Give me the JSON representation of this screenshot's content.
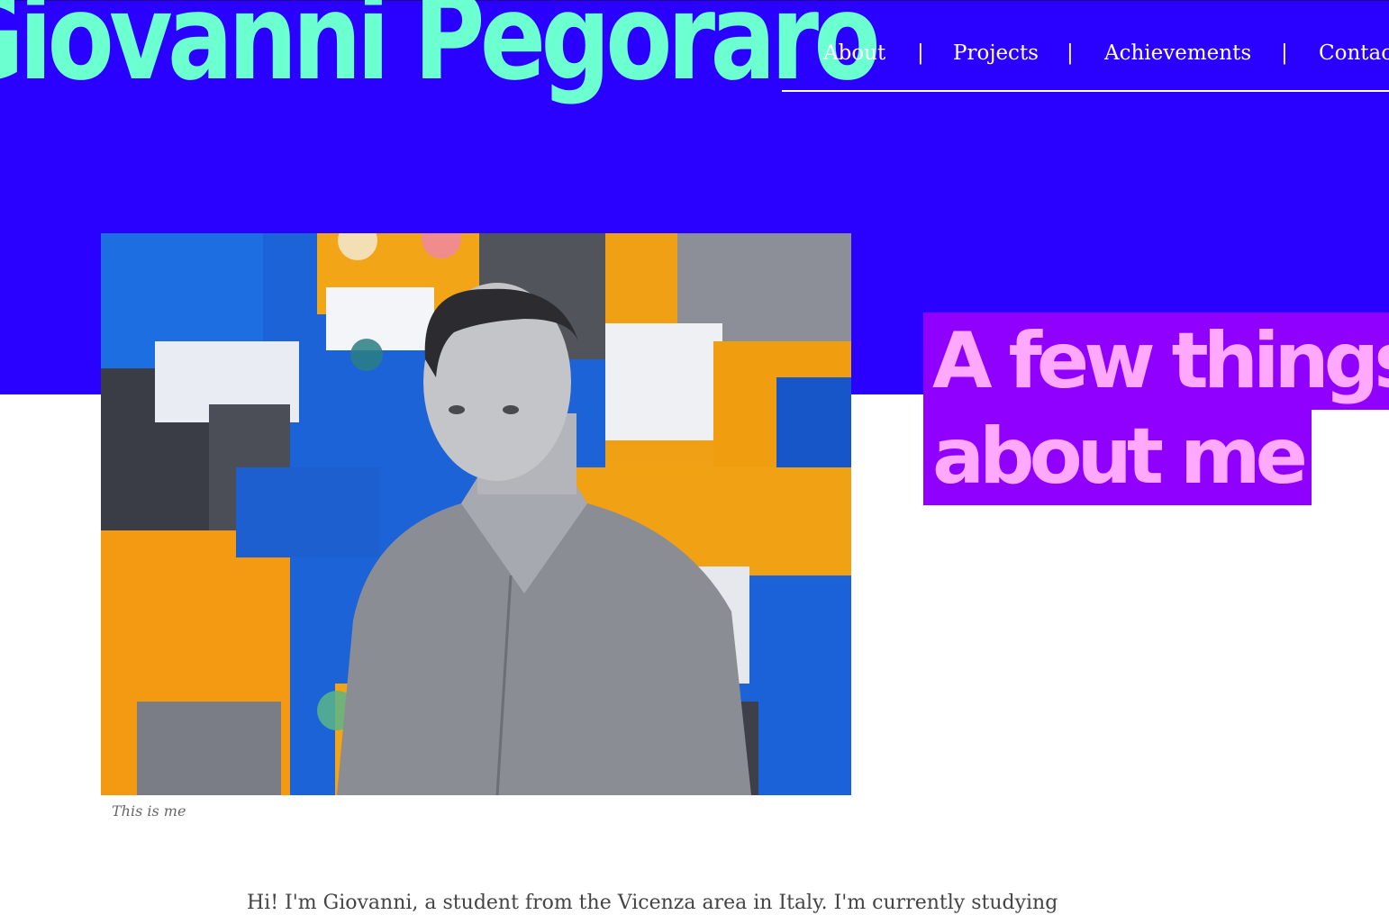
{
  "header": {
    "site_title": "Giovanni Pegoraro",
    "nav": [
      {
        "label": "About"
      },
      {
        "label": "Projects"
      },
      {
        "label": "Achievements"
      },
      {
        "label": "Contact"
      }
    ],
    "separator": "|"
  },
  "colors": {
    "hero_background": "#2a00ff",
    "title_color": "#6cffd0",
    "heading_background": "#9000ff",
    "heading_text": "#ffa8ff"
  },
  "about": {
    "photo_caption": "This is me",
    "heading_line1": "A few things",
    "heading_line2": "about me",
    "intro": "Hi! I'm Giovanni, a student from the Vicenza area in Italy. I'm currently studying"
  },
  "icons": []
}
